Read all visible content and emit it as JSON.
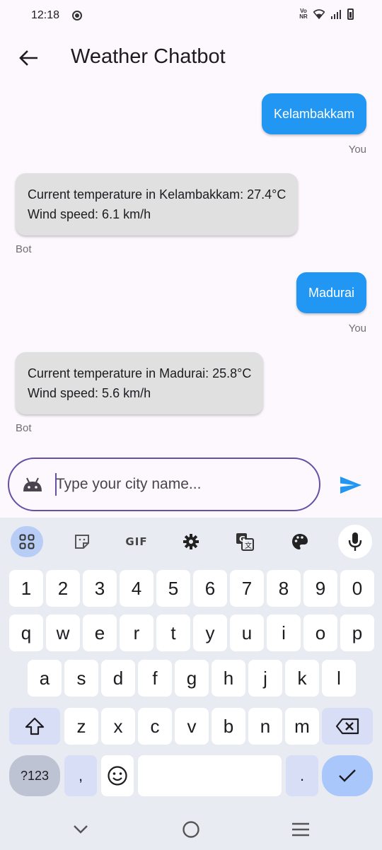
{
  "status": {
    "time": "12:18",
    "volte": "Vo NR"
  },
  "app_bar": {
    "title": "Weather Chatbot"
  },
  "messages": [
    {
      "sender": "You",
      "text": "Kelambakkam"
    },
    {
      "sender": "Bot",
      "line1": "Current temperature in Kelambakkam: 27.4°C",
      "line2": "Wind speed: 6.1 km/h"
    },
    {
      "sender": "You",
      "text": "Madurai"
    },
    {
      "sender": "Bot",
      "line1": "Current temperature in Madurai: 25.8°C",
      "line2": "Wind speed: 5.6 km/h"
    }
  ],
  "input": {
    "placeholder": "Type your city name...",
    "value": ""
  },
  "keyboard": {
    "toolbar": [
      "apps-icon",
      "sticker-icon",
      "GIF",
      "settings-icon",
      "translate-icon",
      "palette-icon",
      "mic-icon"
    ],
    "gif_label": "GIF",
    "row_numbers": [
      "1",
      "2",
      "3",
      "4",
      "5",
      "6",
      "7",
      "8",
      "9",
      "0"
    ],
    "row1": [
      "q",
      "w",
      "e",
      "r",
      "t",
      "y",
      "u",
      "i",
      "o",
      "p"
    ],
    "row2": [
      "a",
      "s",
      "d",
      "f",
      "g",
      "h",
      "j",
      "k",
      "l"
    ],
    "row3": [
      "z",
      "x",
      "c",
      "v",
      "b",
      "n",
      "m"
    ],
    "sym_label": "?123",
    "comma": ",",
    "period": "."
  },
  "colors": {
    "accent": "#2196f3",
    "bubble_bot": "#e0e0e0",
    "focus_border": "#6750a4",
    "send": "#2196f3"
  }
}
